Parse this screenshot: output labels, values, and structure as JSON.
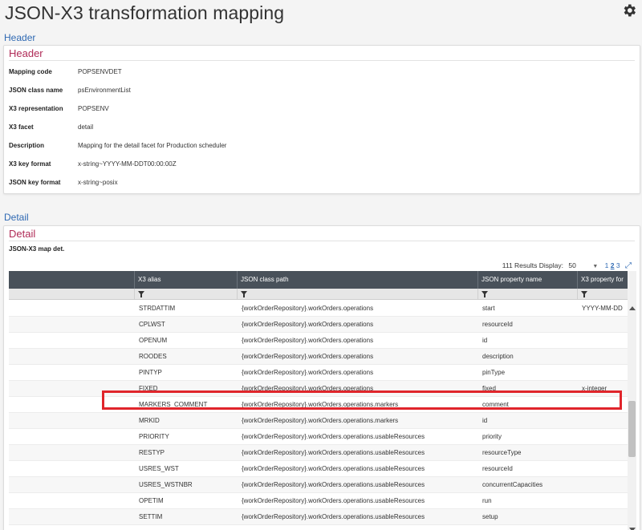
{
  "page": {
    "title": "JSON-X3 transformation mapping"
  },
  "icons": {
    "settings": "gear-icon",
    "filter": "filter-icon",
    "expand": "expand-icon",
    "dropdown": "chevron-down-icon"
  },
  "header_section": {
    "label": "Header",
    "card_title": "Header",
    "fields": [
      {
        "label": "Mapping code",
        "value": "POPSENVDET"
      },
      {
        "label": "JSON class name",
        "value": "psEnvironmentList"
      },
      {
        "label": "X3 representation",
        "value": "POPSENV"
      },
      {
        "label": "X3 facet",
        "value": "detail"
      },
      {
        "label": "Description",
        "value": "Mapping for the detail facet for Production scheduler"
      },
      {
        "label": "X3 key format",
        "value": "x-string~YYYY-MM-DDT00:00:00Z"
      },
      {
        "label": "JSON key format",
        "value": "x-string~posix"
      }
    ]
  },
  "detail_section": {
    "label": "Detail",
    "card_title": "Detail",
    "caption": "JSON-X3 map det.",
    "results": {
      "count_text": "111 Results",
      "display_label": "Display:",
      "display_value": "50",
      "pages": [
        "1",
        "2",
        "3"
      ],
      "current_page": "2"
    },
    "columns": [
      "X3 alias",
      "JSON class path",
      "JSON property name",
      "X3 property for"
    ],
    "rows": [
      {
        "alias": "STRDATTIM",
        "path": "{workOrderRepository}.workOrders.operations",
        "prop": "start",
        "x3": "YYYY-MM-DD"
      },
      {
        "alias": "CPLWST",
        "path": "{workOrderRepository}.workOrders.operations",
        "prop": "resourceId",
        "x3": ""
      },
      {
        "alias": "OPENUM",
        "path": "{workOrderRepository}.workOrders.operations",
        "prop": "id",
        "x3": ""
      },
      {
        "alias": "ROODES",
        "path": "{workOrderRepository}.workOrders.operations",
        "prop": "description",
        "x3": ""
      },
      {
        "alias": "PINTYP",
        "path": "{workOrderRepository}.workOrders.operations",
        "prop": "pinType",
        "x3": ""
      },
      {
        "alias": "FIXED",
        "path": "{workOrderRepository}.workOrders.operations",
        "prop": "fixed",
        "x3": "x-integer"
      },
      {
        "alias": "MARKERS_COMMENT",
        "path": "{workOrderRepository}.workOrders.operations.markers",
        "prop": "comment",
        "x3": ""
      },
      {
        "alias": "MRKID",
        "path": "{workOrderRepository}.workOrders.operations.markers",
        "prop": "id",
        "x3": ""
      },
      {
        "alias": "PRIORITY",
        "path": "{workOrderRepository}.workOrders.operations.usableResources",
        "prop": "priority",
        "x3": ""
      },
      {
        "alias": "RESTYP",
        "path": "{workOrderRepository}.workOrders.operations.usableResources",
        "prop": "resourceType",
        "x3": ""
      },
      {
        "alias": "USRES_WST",
        "path": "{workOrderRepository}.workOrders.operations.usableResources",
        "prop": "resourceId",
        "x3": ""
      },
      {
        "alias": "USRES_WSTNBR",
        "path": "{workOrderRepository}.workOrders.operations.usableResources",
        "prop": "concurrentCapacities",
        "x3": ""
      },
      {
        "alias": "OPETIM",
        "path": "{workOrderRepository}.workOrders.operations.usableResources",
        "prop": "run",
        "x3": ""
      },
      {
        "alias": "SETTIM",
        "path": "{workOrderRepository}.workOrders.operations.usableResources",
        "prop": "setup",
        "x3": ""
      }
    ],
    "highlighted_alias": "FIXED"
  },
  "colors": {
    "title_blue": "#2f69b3",
    "card_title": "#b02b57",
    "grid_header": "#49515a",
    "highlight": "#e0252b"
  }
}
